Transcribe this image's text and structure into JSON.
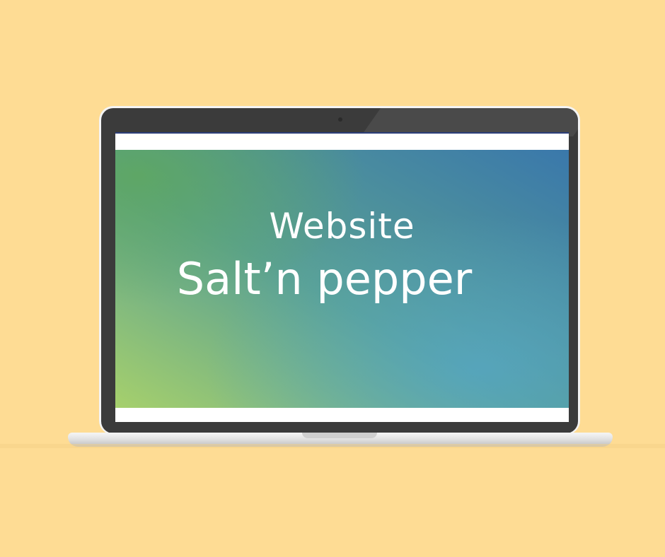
{
  "colors": {
    "background": "#fedc94",
    "bezel": "#3b3b3b",
    "frame": "#f4f4f4",
    "hero_gradient_start": "#9ecb67",
    "hero_gradient_end": "#3f7fb0",
    "text": "#ffffff"
  },
  "hero": {
    "title": "Website",
    "subtitle": "Salt’n pepper"
  }
}
